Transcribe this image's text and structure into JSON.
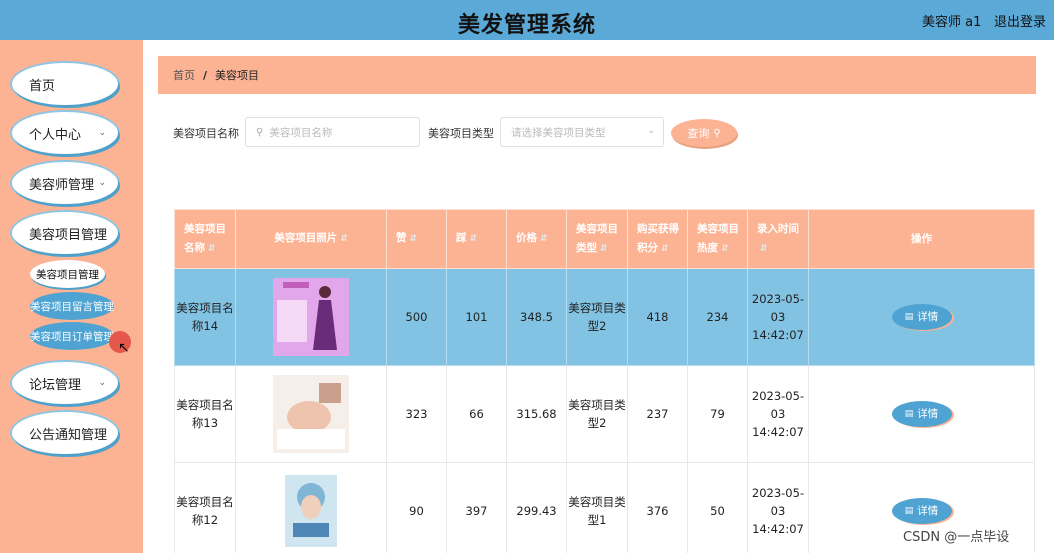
{
  "app": {
    "title": "美发管理系统",
    "user": "美容师 a1",
    "logout": "退出登录"
  },
  "sidebar": {
    "items": [
      {
        "label": "首页",
        "has_children": false
      },
      {
        "label": "个人中心",
        "has_children": true
      },
      {
        "label": "美容师管理",
        "has_children": true
      },
      {
        "label": "美容项目管理",
        "has_children": true
      },
      {
        "label": "论坛管理",
        "has_children": true
      },
      {
        "label": "公告通知管理",
        "has_children": false
      }
    ],
    "sub_items": [
      {
        "label": "美容项目管理",
        "active": true
      },
      {
        "label": "美容项目留言管理",
        "active": false
      },
      {
        "label": "美容项目订单管理",
        "active": false
      }
    ]
  },
  "breadcrumb": {
    "home": "首页",
    "separator": "/",
    "current": "美容项目"
  },
  "search": {
    "name_label": "美容项目名称",
    "name_placeholder": "美容项目名称",
    "type_label": "美容项目类型",
    "type_placeholder": "请选择美容项目类型",
    "query_button": "查询"
  },
  "table": {
    "columns": [
      "美容项目名称",
      "美容项目照片",
      "赞",
      "踩",
      "价格",
      "美容项目类型",
      "购买获得积分",
      "美容项目热度",
      "录入时间",
      "操作"
    ],
    "rows": [
      {
        "name": "美容项目名称14",
        "likes": "500",
        "dislikes": "101",
        "price": "348.5",
        "type": "美容项目类型2",
        "points": "418",
        "heat": "234",
        "time": "2023-05-03 14:42:07",
        "highlighted": true
      },
      {
        "name": "美容项目名称13",
        "likes": "323",
        "dislikes": "66",
        "price": "315.68",
        "type": "美容项目类型2",
        "points": "237",
        "heat": "79",
        "time": "2023-05-03 14:42:07",
        "highlighted": false
      },
      {
        "name": "美容项目名称12",
        "likes": "90",
        "dislikes": "397",
        "price": "299.43",
        "type": "美容项目类型1",
        "points": "376",
        "heat": "50",
        "time": "2023-05-03 14:42:07",
        "highlighted": false
      }
    ],
    "detail_button": "详情"
  },
  "watermark": "CSDN @一点毕设",
  "colors": {
    "header": "#5aa9d6",
    "sidebar": "#fcb393",
    "accent_blue": "#4ea3d3",
    "row_highlight": "#82c3e3"
  }
}
